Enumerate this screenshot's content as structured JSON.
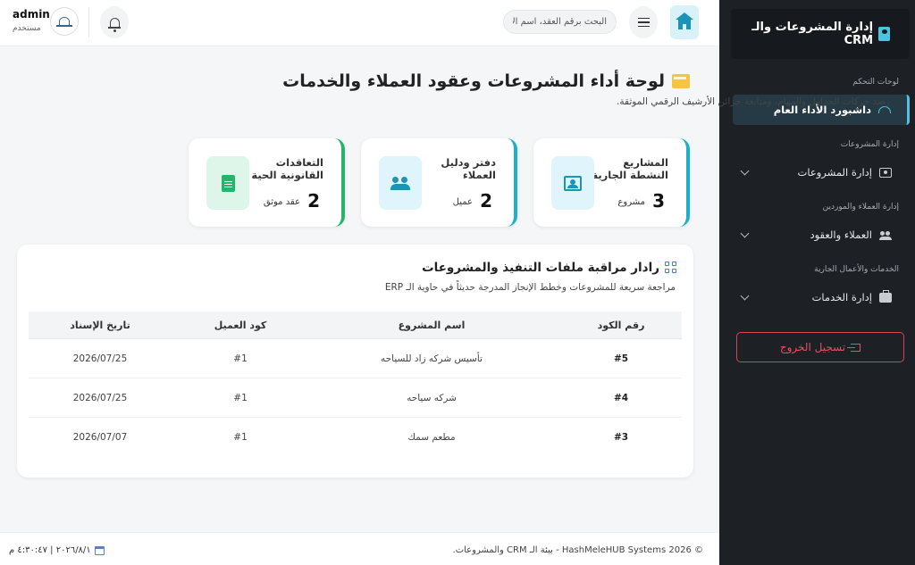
{
  "header": {
    "search_placeholder": "البحث برقم العقد، اسم الا",
    "user_name": "admin",
    "user_role": "مستخدم"
  },
  "sidebar": {
    "brand": "إدارة المشروعات والـ CRM",
    "sections": [
      {
        "title": "لوحات التحكم",
        "items": [
          {
            "label": "داشبورد الأداء العام",
            "icon": "gauge-icon",
            "active": true
          }
        ]
      },
      {
        "title": "إدارة المشروعات",
        "items": [
          {
            "label": "إدارة المشروعات",
            "icon": "user-square-icon"
          }
        ]
      },
      {
        "title": "إدارة العملاء والموردين",
        "items": [
          {
            "label": "العملاء والعقود",
            "icon": "users-icon"
          }
        ]
      },
      {
        "title": "الخدمات والأعمال الجارية",
        "items": [
          {
            "label": "إدارة الخدمات",
            "icon": "briefcase-icon"
          }
        ]
      }
    ],
    "logout_label": "تسجيل الخروج"
  },
  "main": {
    "title": "لوحة أداء المشروعات وعقود العملاء والخدمات",
    "subtitle": "رصد حركات الجداول والمهام، ومتابعة خزائن الأرشيف الرقمي الموثقة.",
    "stats": [
      {
        "label": "المشاريع النشطة الجارية",
        "value": "3",
        "unit": "مشروع",
        "icon": "project-icon"
      },
      {
        "label": "دفتر ودليل العملاء",
        "value": "2",
        "unit": "عميل",
        "icon": "people-icon"
      },
      {
        "label": "التعاقدات القانونية الحية",
        "value": "2",
        "unit": "عقد موثق",
        "icon": "document-icon"
      }
    ],
    "panel": {
      "title": "رادار مراقبة ملفات التنفيذ والمشروعات",
      "subtitle": "مراجعة سريعة للمشروعات وخطط الإنجاز المدرجة حديثاً في حاوية الـ ERP",
      "columns": [
        "رقم الكود",
        "اسم المشروع",
        "كود العميل",
        "تاريخ الإسناد"
      ],
      "rows": [
        [
          "#5",
          "تأسيس شركه زاد للسياحه",
          "#1",
          "2026/07/25"
        ],
        [
          "#4",
          "شركه سياحه",
          "#1",
          "2026/07/25"
        ],
        [
          "#3",
          "مطعم سمك",
          "#1",
          "2026/07/07"
        ]
      ]
    }
  },
  "footer": {
    "copyright": "© 2026 HashMeleHUB Systems - بيئة الـ CRM والمشروعات.",
    "datetime": "٢٠٢٦/٨/١ | ٤:٣٠:٤٧ م"
  }
}
